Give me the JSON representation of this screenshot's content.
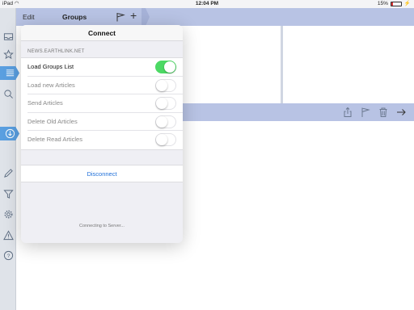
{
  "status_bar": {
    "device": "iPad",
    "time": "12:04 PM",
    "battery": "15%"
  },
  "toolbar": {
    "edit_label": "Edit",
    "title": "Groups",
    "add_label": "+"
  },
  "sidebar": {
    "items": [
      {
        "icon": "inbox-icon"
      },
      {
        "icon": "star-icon"
      },
      {
        "icon": "list-icon",
        "active": true
      },
      {
        "icon": "search-icon"
      },
      {
        "icon": "download-icon",
        "active": true
      },
      {
        "icon": "pencil-icon"
      },
      {
        "icon": "filter-icon"
      },
      {
        "icon": "gear-icon"
      },
      {
        "icon": "warning-icon"
      },
      {
        "icon": "help-icon"
      }
    ]
  },
  "popover": {
    "title": "Connect",
    "server": "NEWS.EARTHLINK.NET",
    "rows": [
      {
        "label": "Load Groups List",
        "on": true
      },
      {
        "label": "Load new Articles",
        "on": false
      },
      {
        "label": "Send Articles",
        "on": false
      },
      {
        "label": "Delete Old Articles",
        "on": false
      },
      {
        "label": "Delete Read Articles",
        "on": false
      }
    ],
    "disconnect_label": "Disconnect",
    "status_text": "Connecting to Server..."
  },
  "colors": {
    "accent": "#5a9fe0",
    "toolbar": "#b8c3e4",
    "toggle_on": "#4cd964",
    "link": "#1e6fd9"
  }
}
